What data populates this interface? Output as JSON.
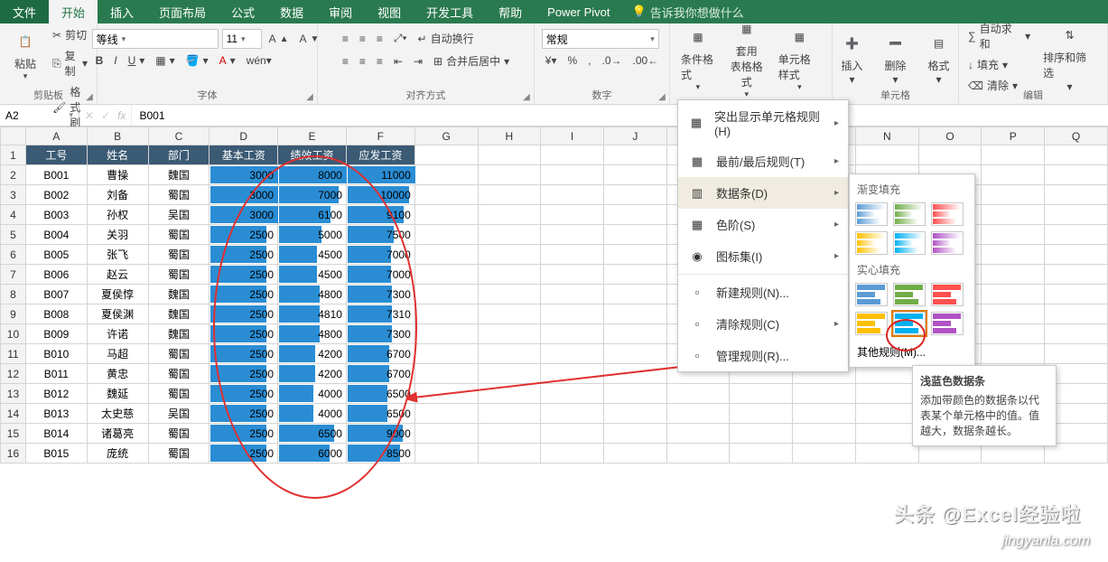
{
  "menu": {
    "file": "文件",
    "home": "开始",
    "insert": "插入",
    "layout": "页面布局",
    "formulas": "公式",
    "data": "数据",
    "review": "审阅",
    "view": "视图",
    "dev": "开发工具",
    "help": "帮助",
    "powerpivot": "Power Pivot",
    "tell": "告诉我你想做什么"
  },
  "clipboard": {
    "paste": "粘贴",
    "cut": "剪切",
    "copy": "复制",
    "painter": "格式刷",
    "label": "剪贴板"
  },
  "font": {
    "name": "等线",
    "size": "11",
    "label": "字体"
  },
  "align": {
    "wrap": "自动换行",
    "merge": "合并后居中",
    "label": "对齐方式"
  },
  "number": {
    "fmt": "常规",
    "label": "数字"
  },
  "styles": {
    "cond": "条件格式",
    "table": "套用\n表格格式",
    "cell": "单元格样式"
  },
  "cells": {
    "insert": "插入",
    "delete": "删除",
    "format": "格式",
    "label": "单元格"
  },
  "editing": {
    "autosum": "自动求和",
    "fill": "填充",
    "clear": "清除",
    "sortfilter": "排序和筛选",
    "label": "编辑"
  },
  "namebox": "A2",
  "formula": "B001",
  "columns": [
    "A",
    "B",
    "C",
    "D",
    "E",
    "F",
    "G",
    "H",
    "I",
    "J",
    "K",
    "L",
    "M",
    "N",
    "O",
    "P",
    "Q"
  ],
  "headers": {
    "c1": "工号",
    "c2": "姓名",
    "c3": "部门",
    "c4": "基本工资",
    "c5": "绩效工资",
    "c6": "应发工资"
  },
  "rows": [
    {
      "id": "B001",
      "name": "曹操",
      "dept": "魏国",
      "base": 3000,
      "perf": 8000,
      "total": 11000
    },
    {
      "id": "B002",
      "name": "刘备",
      "dept": "蜀国",
      "base": 3000,
      "perf": 7000,
      "total": 10000
    },
    {
      "id": "B003",
      "name": "孙权",
      "dept": "吴国",
      "base": 3000,
      "perf": 6100,
      "total": 9100
    },
    {
      "id": "B004",
      "name": "关羽",
      "dept": "蜀国",
      "base": 2500,
      "perf": 5000,
      "total": 7500
    },
    {
      "id": "B005",
      "name": "张飞",
      "dept": "蜀国",
      "base": 2500,
      "perf": 4500,
      "total": 7000
    },
    {
      "id": "B006",
      "name": "赵云",
      "dept": "蜀国",
      "base": 2500,
      "perf": 4500,
      "total": 7000
    },
    {
      "id": "B007",
      "name": "夏侯惇",
      "dept": "魏国",
      "base": 2500,
      "perf": 4800,
      "total": 7300
    },
    {
      "id": "B008",
      "name": "夏侯渊",
      "dept": "魏国",
      "base": 2500,
      "perf": 4810,
      "total": 7310
    },
    {
      "id": "B009",
      "name": "许诺",
      "dept": "魏国",
      "base": 2500,
      "perf": 4800,
      "total": 7300
    },
    {
      "id": "B010",
      "name": "马超",
      "dept": "蜀国",
      "base": 2500,
      "perf": 4200,
      "total": 6700
    },
    {
      "id": "B011",
      "name": "黄忠",
      "dept": "蜀国",
      "base": 2500,
      "perf": 4200,
      "total": 6700
    },
    {
      "id": "B012",
      "name": "魏延",
      "dept": "蜀国",
      "base": 2500,
      "perf": 4000,
      "total": 6500
    },
    {
      "id": "B013",
      "name": "太史慈",
      "dept": "吴国",
      "base": 2500,
      "perf": 4000,
      "total": 6500
    },
    {
      "id": "B014",
      "name": "诸葛亮",
      "dept": "蜀国",
      "base": 2500,
      "perf": 6500,
      "total": 9000
    },
    {
      "id": "B015",
      "name": "庞统",
      "dept": "蜀国",
      "base": 2500,
      "perf": 6000,
      "total": 8500
    }
  ],
  "max": {
    "base": 3000,
    "perf": 8000,
    "total": 11000
  },
  "cfmenu": {
    "highlight": "突出显示单元格规则(H)",
    "toprules": "最前/最后规则(T)",
    "databars": "数据条(D)",
    "colorscales": "色阶(S)",
    "iconsets": "图标集(I)",
    "newrule": "新建规则(N)...",
    "clear": "清除规则(C)",
    "manage": "管理规则(R)..."
  },
  "submenu": {
    "gradient": "渐变填充",
    "solid": "实心填充",
    "other": "其他规则(M)..."
  },
  "tooltip": {
    "title": "浅蓝色数据条",
    "body": "添加带颜色的数据条以代表某个单元格中的值。值越大，数据条越长。"
  },
  "watermarks": {
    "w1": "头条 @Excel经验啦",
    "w2": "jingyanla.com"
  }
}
